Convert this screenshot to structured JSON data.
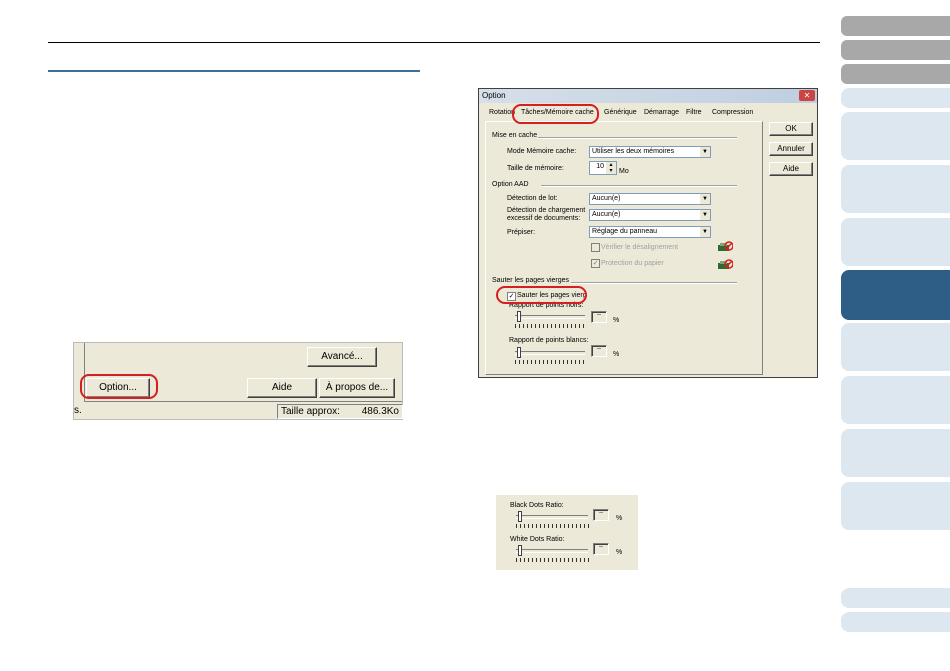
{
  "screenshot1": {
    "buttons": {
      "advanced": "Avancé...",
      "option": "Option...",
      "help": "Aide",
      "about": "À propos de..."
    },
    "status": {
      "left_fragment": "s.",
      "size_label": "Taille approx:",
      "size_value": "486.3Ko"
    }
  },
  "dialog": {
    "title": "Option",
    "close_glyph": "✕",
    "tabs": [
      {
        "label": "Rotation"
      },
      {
        "label": "Tâches/Mémoire cache"
      },
      {
        "label": "Générique"
      },
      {
        "label": "Démarrage"
      },
      {
        "label": "Filtre"
      },
      {
        "label": "Compression"
      }
    ],
    "buttons": {
      "ok": "OK",
      "cancel": "Annuler",
      "help": "Aide"
    },
    "cache": {
      "group_label": "Mise en cache",
      "mode_label": "Mode Mémoire cache:",
      "mode_value": "Utiliser les deux mémoires",
      "size_label": "Taille de mémoire:",
      "size_value": "10",
      "size_unit": "Mo"
    },
    "adf": {
      "group_label": "Option AAD",
      "batch_label": "Détection de lot:",
      "batch_value": "Aucun(e)",
      "overload_label_1": "Détection de chargement",
      "overload_label_2": "excessif de documents:",
      "overload_value": "Aucun(e)",
      "prepick_label": "Prépiser:",
      "prepick_value": "Réglage du panneau",
      "skew_label": "Vérifier le désalignement",
      "paper_label": "Protection du papier"
    },
    "blank": {
      "group_label": "Sauter les pages vierges",
      "skip_label": "Sauter les pages vierg",
      "black_label": "Rapport de points noirs:",
      "white_label": "Rapport de points blancs:",
      "black_value": "--",
      "white_value": "--",
      "percent": "%"
    }
  },
  "panel3": {
    "black_label": "Black Dots Ratio:",
    "white_label": "White Dots Ratio:",
    "black_value": "--",
    "white_value": "--",
    "percent": "%"
  }
}
